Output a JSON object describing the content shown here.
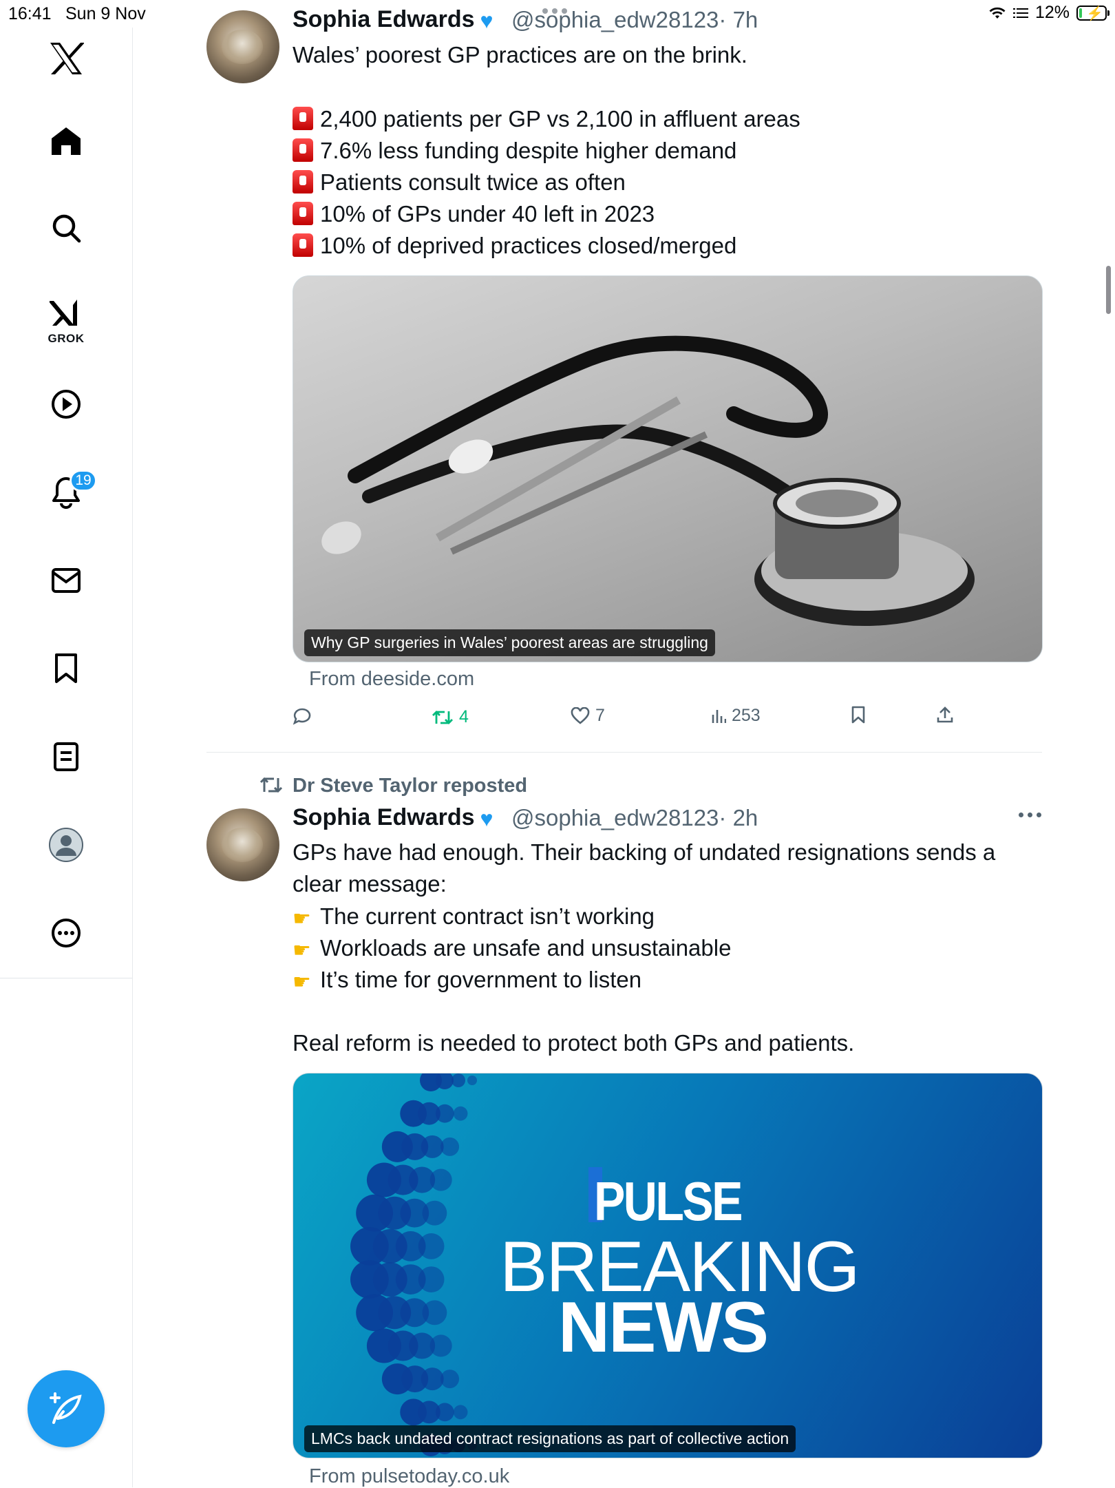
{
  "status_bar": {
    "time": "16:41",
    "date": "Sun 9 Nov",
    "battery": "12%",
    "battery_level": 0.12
  },
  "sidebar": {
    "items": [
      {
        "name": "x-logo-icon"
      },
      {
        "name": "home-icon"
      },
      {
        "name": "search-icon"
      },
      {
        "name": "grok-icon",
        "label": "GROK"
      },
      {
        "name": "video-icon"
      },
      {
        "name": "notifications-icon",
        "badge": "19"
      },
      {
        "name": "messages-icon"
      },
      {
        "name": "bookmarks-icon"
      },
      {
        "name": "lists-icon"
      },
      {
        "name": "profile-icon"
      },
      {
        "name": "more-icon"
      }
    ]
  },
  "tweets": [
    {
      "author": "Sophia Edwards",
      "handle": "@sophia_edw28123",
      "time": "· 7h",
      "lines": [
        "Wales’ poorest GP practices are on the brink.",
        "2,400 patients per GP vs 2,100 in affluent areas",
        "7.6% less funding despite higher demand",
        "Patients consult twice as often",
        "10% of GPs under 40 left in 2023",
        "10% of deprived practices closed/merged"
      ],
      "card_caption": "Why GP surgeries in Wales’ poorest areas are struggling",
      "card_source": "From deeside.com",
      "reposts": "4",
      "likes": "7",
      "views": "253"
    },
    {
      "reposted_by": "Dr Steve Taylor reposted",
      "author": "Sophia Edwards",
      "handle": "@sophia_edw28123",
      "time": "· 2h",
      "lines": [
        "GPs have had enough. Their backing of undated resignations sends a",
        "clear message:",
        "The current contract isn’t working",
        "Workloads are unsafe and unsustainable",
        "It’s time for government to listen",
        "Real reform is needed to protect both GPs and patients."
      ],
      "card_logo": "PULSE",
      "card_headline_1": "BREAKING",
      "card_headline_2": "NEWS",
      "card_caption": "LMCs back undated contract resignations as part of collective action",
      "card_source": "From pulsetoday.co.uk"
    }
  ],
  "colors": {
    "accent": "#1d9bf0",
    "repost_green": "#00ba7c",
    "muted": "#536471"
  }
}
